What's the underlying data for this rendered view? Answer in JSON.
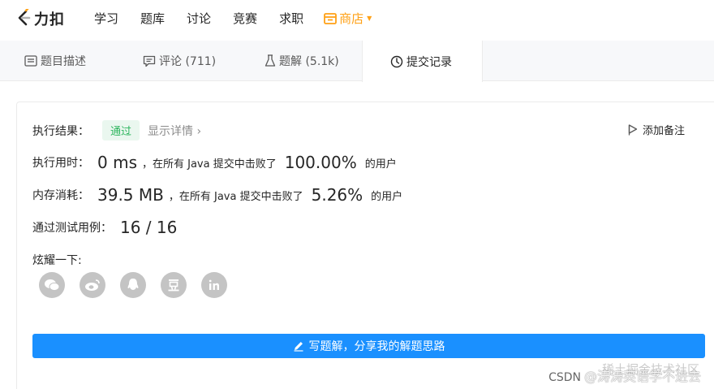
{
  "nav": {
    "logo_text": "力扣",
    "items": [
      "学习",
      "题库",
      "讨论",
      "竞赛",
      "求职"
    ],
    "store_label": "商店"
  },
  "tabs": [
    {
      "label": "题目描述",
      "icon": "description-icon"
    },
    {
      "label": "评论 (711)",
      "icon": "comment-icon"
    },
    {
      "label": "题解 (5.1k)",
      "icon": "flask-icon"
    },
    {
      "label": "提交记录",
      "icon": "clock-icon",
      "active": true
    }
  ],
  "result": {
    "result_label": "执行结果：",
    "status": "通过",
    "details_link": "显示详情 ›",
    "add_note": "添加备注",
    "runtime_label": "执行用时：",
    "runtime_value": "0 ms",
    "runtime_text": "，在所有 Java 提交中击败了",
    "runtime_percent": "100.00%",
    "runtime_suffix": "的用户",
    "memory_label": "内存消耗：",
    "memory_value": "39.5 MB",
    "memory_text": "，在所有 Java 提交中击败了",
    "memory_percent": "5.26%",
    "memory_suffix": "的用户",
    "tests_label": "通过测试用例：",
    "tests_value": "16 / 16",
    "share_label": "炫耀一下:",
    "share_icons": [
      "wechat-icon",
      "weibo-icon",
      "qq-icon",
      "douban-icon",
      "linkedin-icon"
    ],
    "write_solution": "写题解，分享我的解题思路"
  },
  "watermark": {
    "prefix": "CSDN",
    "text": "@涛涛英语学不进去",
    "overlay": "稀土掘金技术社区"
  },
  "colors": {
    "accent": "#ffa116",
    "success": "#2db55d",
    "primary_button": "#1a90ff"
  }
}
